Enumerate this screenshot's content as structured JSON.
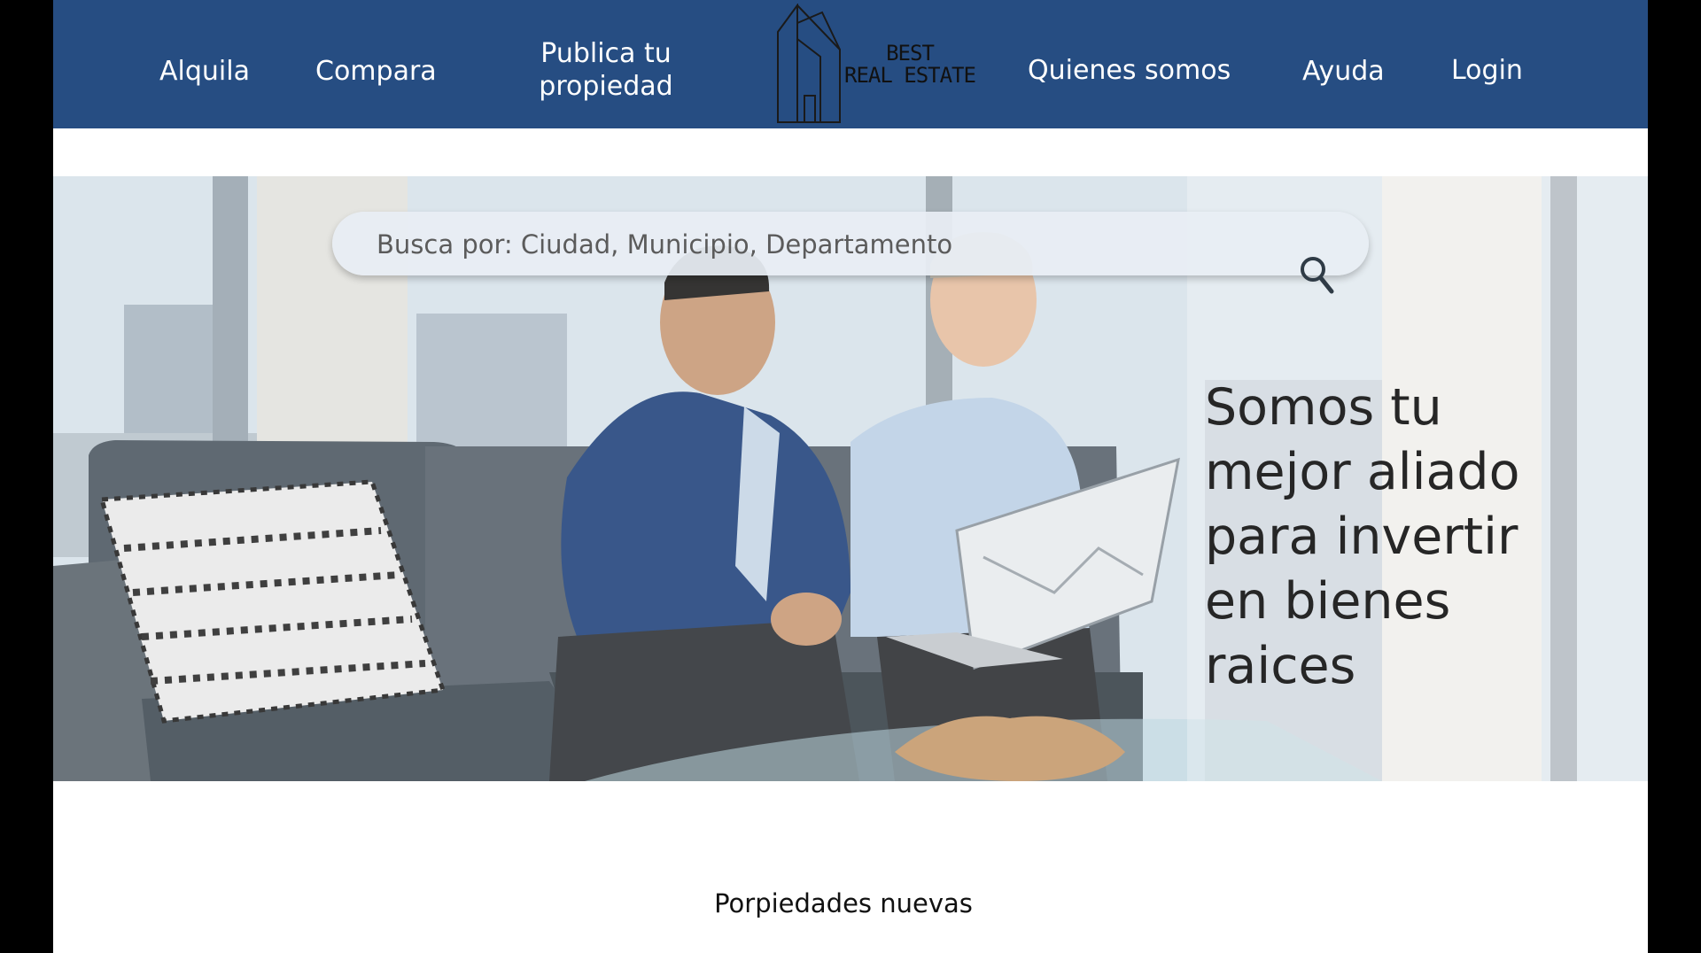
{
  "nav": {
    "items": [
      {
        "label": "Alquila"
      },
      {
        "label": "Compara"
      },
      {
        "label": "Publica tu propiedad"
      },
      {
        "label": "Quienes somos"
      },
      {
        "label": "Ayuda"
      },
      {
        "label": "Login"
      }
    ],
    "logo": {
      "line1": "BEST",
      "line2": "REAL ESTATE",
      "icon": "house-outline-icon"
    }
  },
  "hero": {
    "search": {
      "placeholder": "Busca por: Ciudad, Municipio, Departamento",
      "value": "",
      "icon": "search-icon"
    },
    "tagline": "Somos tu mejor aliado para invertir en bienes raices",
    "image": "two-men-on-sofa-with-laptop-photo"
  },
  "sections": {
    "new_properties_title": "Porpiedades nuevas"
  },
  "colors": {
    "header_bg": "#264d82",
    "page_bg": "#ffffff",
    "frame": "#000000"
  }
}
